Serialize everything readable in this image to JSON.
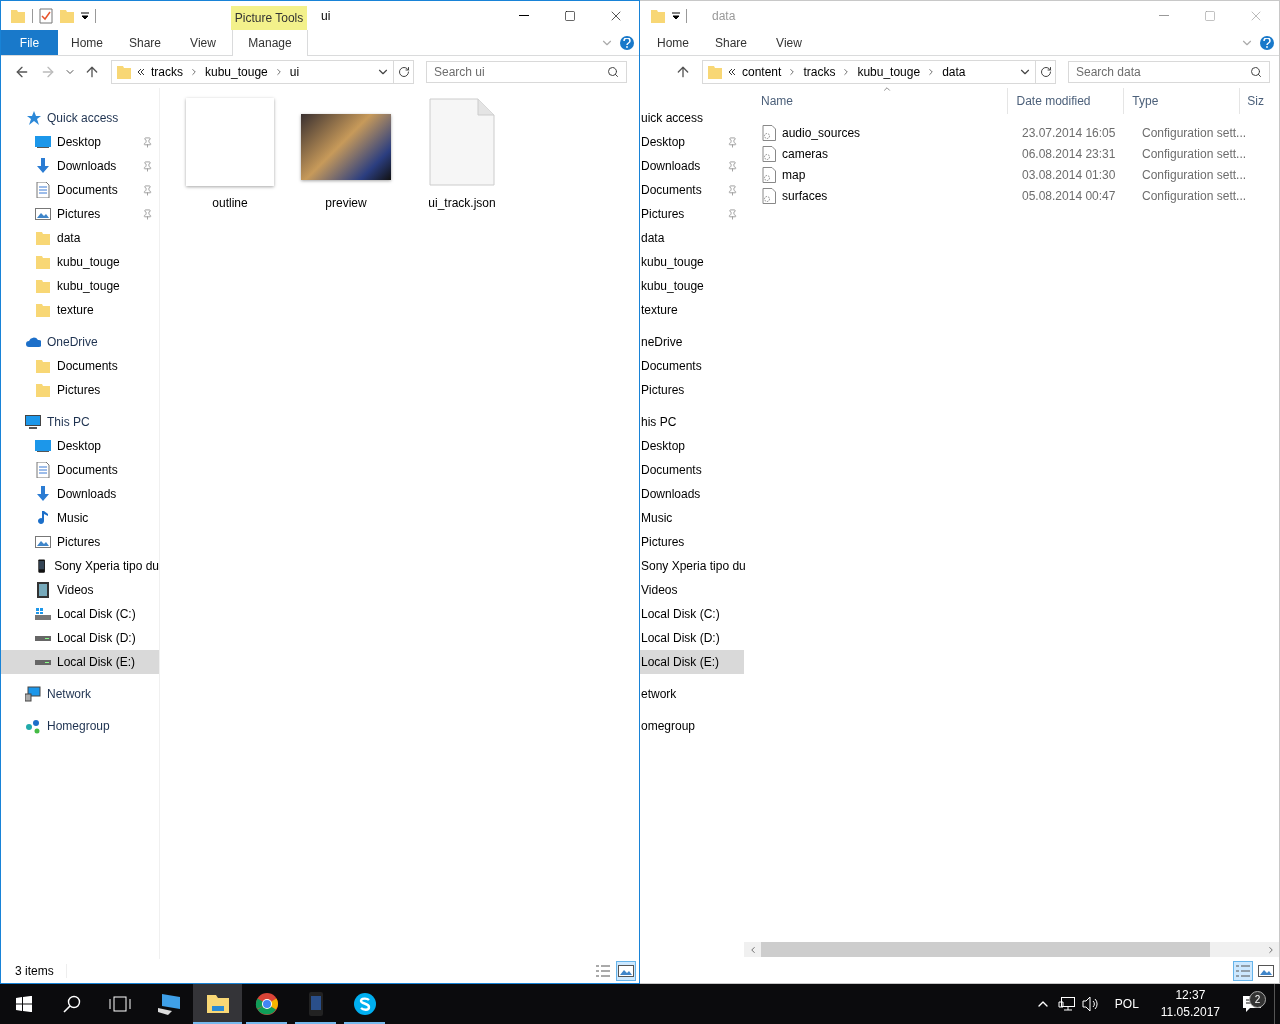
{
  "left_window": {
    "title": "ui",
    "active": true,
    "context_label": "Picture Tools",
    "ribbon_tabs": [
      {
        "label": "File",
        "kind": "file"
      },
      {
        "label": "Home",
        "kind": "tab"
      },
      {
        "label": "Share",
        "kind": "tab"
      },
      {
        "label": "View",
        "kind": "tab"
      },
      {
        "label": "Manage",
        "kind": "context"
      }
    ],
    "breadcrumb": [
      "tracks",
      "kubu_touge",
      "ui"
    ],
    "search": {
      "placeholder": "Search ui"
    },
    "nav": [
      {
        "label": "Quick access",
        "kind": "star",
        "selected": false,
        "children": [
          {
            "label": "Desktop",
            "kind": "desktop",
            "pinned": true,
            "selected": false
          },
          {
            "label": "Downloads",
            "kind": "downloads",
            "pinned": true,
            "selected": false
          },
          {
            "label": "Documents",
            "kind": "documents",
            "pinned": true,
            "selected": false
          },
          {
            "label": "Pictures",
            "kind": "pictures",
            "pinned": true,
            "selected": false
          },
          {
            "label": "data",
            "kind": "folder",
            "pinned": false,
            "selected": false
          },
          {
            "label": "kubu_touge",
            "kind": "folder",
            "pinned": false,
            "selected": false
          },
          {
            "label": "kubu_touge",
            "kind": "folder",
            "pinned": false,
            "selected": false
          },
          {
            "label": "texture",
            "kind": "folder",
            "pinned": false,
            "selected": false
          }
        ]
      },
      {
        "label": "OneDrive",
        "kind": "cloud",
        "selected": false,
        "children": [
          {
            "label": "Documents",
            "kind": "folder",
            "pinned": false,
            "selected": false
          },
          {
            "label": "Pictures",
            "kind": "folder",
            "pinned": false,
            "selected": false
          }
        ]
      },
      {
        "label": "This PC",
        "kind": "computer",
        "selected": false,
        "children": [
          {
            "label": "Desktop",
            "kind": "desktop",
            "pinned": false,
            "selected": false
          },
          {
            "label": "Documents",
            "kind": "documents",
            "pinned": false,
            "selected": false
          },
          {
            "label": "Downloads",
            "kind": "downloads",
            "pinned": false,
            "selected": false
          },
          {
            "label": "Music",
            "kind": "music",
            "pinned": false,
            "selected": false
          },
          {
            "label": "Pictures",
            "kind": "pictures",
            "pinned": false,
            "selected": false
          },
          {
            "label": "Sony Xperia tipo du",
            "kind": "phone",
            "pinned": false,
            "selected": false
          },
          {
            "label": "Videos",
            "kind": "videos",
            "pinned": false,
            "selected": false
          },
          {
            "label": "Local Disk (C:)",
            "kind": "system-drive",
            "pinned": false,
            "selected": false
          },
          {
            "label": "Local Disk (D:)",
            "kind": "drive",
            "pinned": false,
            "selected": false
          },
          {
            "label": "Local Disk (E:)",
            "kind": "drive",
            "pinned": false,
            "selected": true
          }
        ]
      },
      {
        "label": "Network",
        "kind": "network",
        "selected": false
      },
      {
        "label": "Homegroup",
        "kind": "homegroup",
        "selected": false
      }
    ],
    "items": [
      {
        "name": "outline",
        "kind": "blank-image"
      },
      {
        "name": "preview",
        "kind": "photo"
      },
      {
        "name": "ui_track.json",
        "kind": "document"
      }
    ],
    "status": "3 items",
    "view_buttons": [
      {
        "kind": "details",
        "selected": false
      },
      {
        "kind": "large-icons",
        "selected": true
      }
    ]
  },
  "right_window": {
    "title": "data",
    "active": false,
    "ribbon_tabs": [
      {
        "label": "Home",
        "kind": "tab"
      },
      {
        "label": "Share",
        "kind": "tab"
      },
      {
        "label": "View",
        "kind": "tab"
      }
    ],
    "breadcrumb": [
      "content",
      "tracks",
      "kubu_touge",
      "data"
    ],
    "search": {
      "placeholder": "Search data"
    },
    "nav": [
      {
        "label": "uick access",
        "selected": false,
        "children": [
          {
            "label": "Desktop",
            "pinned": true,
            "selected": false
          },
          {
            "label": "Downloads",
            "pinned": true,
            "selected": false
          },
          {
            "label": "Documents",
            "pinned": true,
            "selected": false
          },
          {
            "label": "Pictures",
            "pinned": true,
            "selected": false
          },
          {
            "label": "data",
            "pinned": false,
            "selected": false
          },
          {
            "label": "kubu_touge",
            "pinned": false,
            "selected": false
          },
          {
            "label": "kubu_touge",
            "pinned": false,
            "selected": false
          },
          {
            "label": "texture",
            "pinned": false,
            "selected": false
          }
        ]
      },
      {
        "label": "neDrive",
        "selected": false,
        "children": [
          {
            "label": "Documents",
            "pinned": false,
            "selected": false
          },
          {
            "label": "Pictures",
            "pinned": false,
            "selected": false
          }
        ]
      },
      {
        "label": "his PC",
        "selected": false,
        "children": [
          {
            "label": "Desktop",
            "pinned": false,
            "selected": false
          },
          {
            "label": "Documents",
            "pinned": false,
            "selected": false
          },
          {
            "label": "Downloads",
            "pinned": false,
            "selected": false
          },
          {
            "label": "Music",
            "pinned": false,
            "selected": false
          },
          {
            "label": "Pictures",
            "pinned": false,
            "selected": false
          },
          {
            "label": "Sony Xperia tipo du",
            "pinned": false,
            "selected": false
          },
          {
            "label": "Videos",
            "pinned": false,
            "selected": false
          },
          {
            "label": "Local Disk (C:)",
            "pinned": false,
            "selected": false
          },
          {
            "label": "Local Disk (D:)",
            "pinned": false,
            "selected": false
          },
          {
            "label": "Local Disk (E:)",
            "pinned": false,
            "selected": true
          }
        ]
      },
      {
        "label": "etwork",
        "selected": false
      },
      {
        "label": "omegroup",
        "selected": false
      }
    ],
    "columns": [
      {
        "label": "Name",
        "sorted": true
      },
      {
        "label": "Date modified",
        "sorted": false
      },
      {
        "label": "Type",
        "sorted": false
      },
      {
        "label": "Siz",
        "sorted": false
      }
    ],
    "rows": [
      {
        "name": "audio_sources",
        "date": "23.07.2014 16:05",
        "type": "Configuration sett..."
      },
      {
        "name": "cameras",
        "date": "06.08.2014 23:31",
        "type": "Configuration sett..."
      },
      {
        "name": "map",
        "date": "03.08.2014 01:30",
        "type": "Configuration sett..."
      },
      {
        "name": "surfaces",
        "date": "05.08.2014 00:47",
        "type": "Configuration sett..."
      }
    ],
    "view_buttons": [
      {
        "kind": "details",
        "selected": true
      },
      {
        "kind": "large-icons",
        "selected": false
      }
    ]
  },
  "taskbar": {
    "apps": [
      {
        "kind": "computer",
        "running": false,
        "active": false
      },
      {
        "kind": "explorer",
        "running": true,
        "active": true
      },
      {
        "kind": "chrome",
        "running": true,
        "active": false
      },
      {
        "kind": "phone",
        "running": true,
        "active": false
      },
      {
        "kind": "skype",
        "running": true,
        "active": false
      }
    ],
    "language": "POL",
    "time": "12:37",
    "date": "11.05.2017",
    "notifications": "2"
  }
}
